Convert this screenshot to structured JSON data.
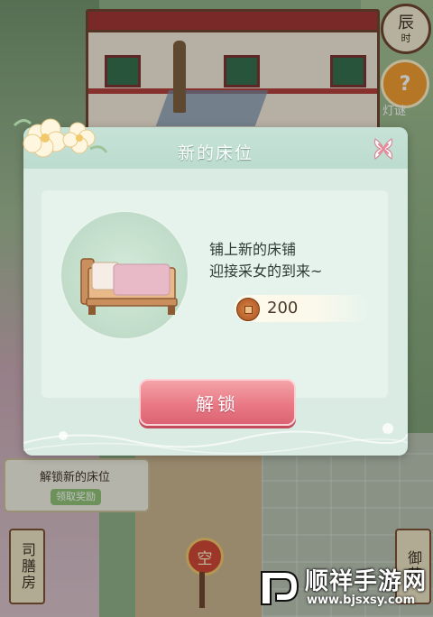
{
  "hud": {
    "time_char": "辰",
    "time_sub": "时",
    "riddle_label": "灯谜",
    "riddle_glyph": "?"
  },
  "task": {
    "title": "解锁新的床位",
    "claim_label": "领取奖励"
  },
  "signs": {
    "left_sign": "司膳房",
    "right_sign": "御花",
    "empty_badge": "空"
  },
  "modal": {
    "title": "新的床位",
    "description_line1": "铺上新的床铺",
    "description_line2": "迎接采女的到来~",
    "cost": "200",
    "unlock_label": "解锁"
  },
  "watermark": {
    "name": "顺祥手游网",
    "url": "www.bjsxsy.com"
  },
  "colors": {
    "modal_bg": "#d9ebe3",
    "button_pink": "#e97985",
    "coin": "#b8602a"
  }
}
